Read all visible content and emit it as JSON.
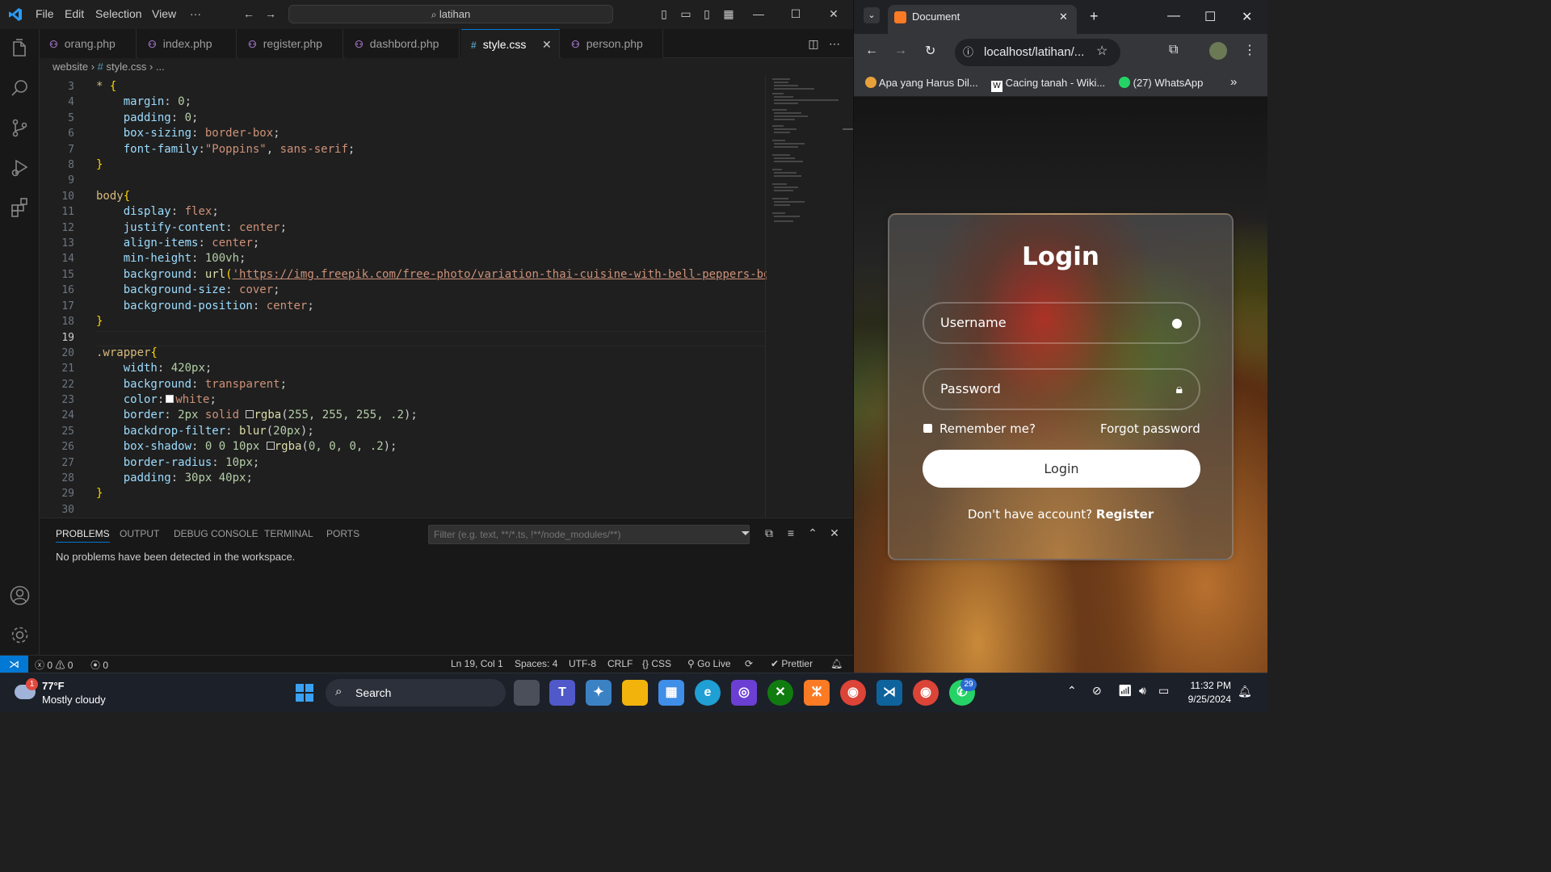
{
  "vscode": {
    "menu": [
      "File",
      "Edit",
      "Selection",
      "View",
      "···"
    ],
    "command_center": "latihan",
    "tabs": [
      {
        "label": "orang.php",
        "icon": "php-icon"
      },
      {
        "label": "index.php",
        "icon": "php-icon"
      },
      {
        "label": "register.php",
        "icon": "php-icon"
      },
      {
        "label": "dashbord.php",
        "icon": "php-icon"
      },
      {
        "label": "style.css",
        "icon": "css-hash-icon",
        "active": true
      },
      {
        "label": "person.php",
        "icon": "php-icon"
      }
    ],
    "breadcrumb": {
      "folder": "website",
      "file": "style.css",
      "more": "..."
    },
    "line_numbers": [
      "3",
      "4",
      "5",
      "6",
      "7",
      "8",
      "9",
      "10",
      "11",
      "12",
      "13",
      "14",
      "15",
      "16",
      "17",
      "18",
      "19",
      "20",
      "21",
      "22",
      "23",
      "24",
      "25",
      "26",
      "27",
      "28",
      "29",
      "30"
    ],
    "code": {
      "l3_sel": "* ",
      "l3_brace": "{",
      "l4_prop": "margin",
      "l4_val": "0",
      "l5_prop": "padding",
      "l5_val": "0",
      "l6_prop": "box-sizing",
      "l6_val": "border-box",
      "l7_prop": "font-family",
      "l7_val1": "\"Poppins\"",
      "l7_val2": "sans-serif",
      "l10_sel": "body",
      "l11_prop": "display",
      "l11_val": "flex",
      "l12_prop": "justify-content",
      "l12_val": "center",
      "l13_prop": "align-items",
      "l13_val": "center",
      "l14_prop": "min-height",
      "l14_num": "100vh",
      "l15_prop": "background",
      "l15_fn": "url",
      "l15_str": "'https://img.freepik.com/free-photo/variation-thai-cuisine-with-bell-peppers-bokchoy-w",
      "l16_prop": "background-size",
      "l16_val": "cover",
      "l17_prop": "background-position",
      "l17_val": "center",
      "l20_sel": ".wrapper",
      "l21_prop": "width",
      "l21_num": "420px",
      "l22_prop": "background",
      "l22_val": "transparent",
      "l23_prop": "color",
      "l23_val": "white",
      "l24_prop": "border",
      "l24_num": "2px",
      "l24_val": "solid",
      "l24_fn": "rgba",
      "l24_args": "255, 255, 255, .2",
      "l25_prop": "backdrop-filter",
      "l25_fn": "blur",
      "l25_num": "20px",
      "l26_prop": "box-shadow",
      "l26_num": "0 0 10px",
      "l26_fn": "rgba",
      "l26_args": "0, 0, 0, .2",
      "l27_prop": "border-radius",
      "l27_num": "10px",
      "l28_prop": "padding",
      "l28_num": "30px 40px"
    },
    "panel": {
      "tabs": [
        "PROBLEMS",
        "OUTPUT",
        "DEBUG CONSOLE",
        "TERMINAL",
        "PORTS"
      ],
      "filter_placeholder": "Filter (e.g. text, **/*.ts, !**/node_modules/**)",
      "message": "No problems have been detected in the workspace."
    },
    "status": {
      "errors": "0",
      "warnings": "0",
      "ports": "0",
      "position": "Ln 19, Col 1",
      "spaces": "Spaces: 4",
      "encoding": "UTF-8",
      "eol": "CRLF",
      "language": "CSS",
      "golive": "Go Live",
      "prettier": "Prettier"
    }
  },
  "browser": {
    "tab_title": "Document",
    "url": "localhost/latihan/...",
    "bookmarks": [
      "Apa yang Harus Dil...",
      "Cacing tanah - Wiki...",
      "(27) WhatsApp"
    ],
    "page": {
      "title": "Login",
      "username_placeholder": "Username",
      "password_placeholder": "Password",
      "remember": "Remember me?",
      "forgot": "Forgot password",
      "login_button": "Login",
      "no_account": "Don't have account?",
      "register": "Register"
    }
  },
  "taskbar": {
    "weather_temp": "77°F",
    "weather_desc": "Mostly cloudy",
    "weather_badge": "1",
    "search": "Search",
    "whatsapp_badge": "29",
    "time": "11:32 PM",
    "date": "9/25/2024"
  },
  "colors": {
    "accent": "#0078d4",
    "editor_bg": "#1f1f1f",
    "php_icon": "#a074c4",
    "css_icon": "#519aba"
  }
}
